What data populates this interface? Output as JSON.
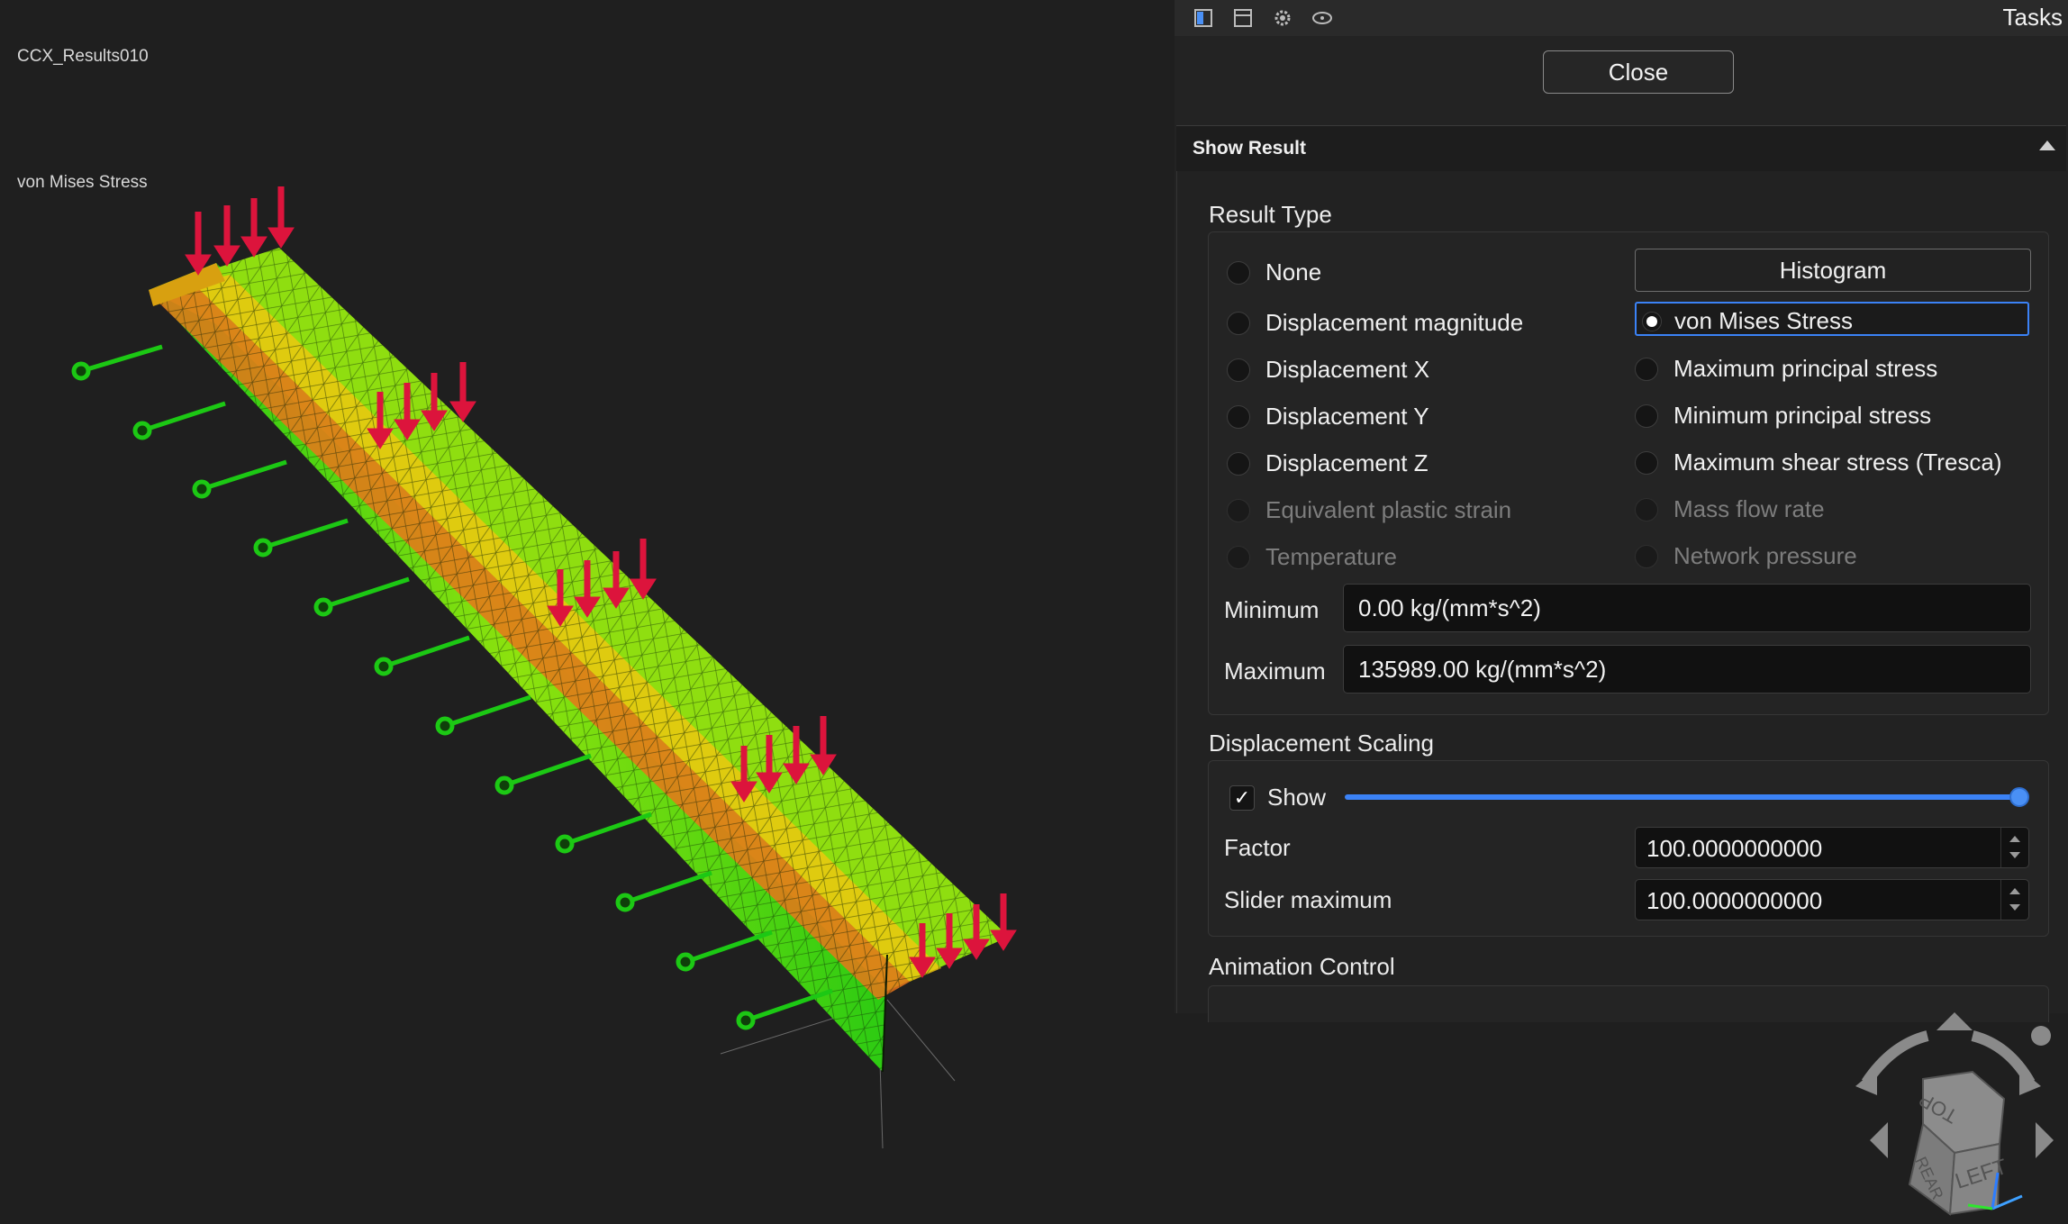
{
  "viewport": {
    "result_name": "CCX_Results010",
    "result_label": "von Mises Stress"
  },
  "tasks": {
    "title": "Tasks",
    "close_label": "Close",
    "toolbar_icons": [
      "panel-icon",
      "window-icon",
      "settings-icon",
      "eye-icon"
    ]
  },
  "show_result": {
    "title": "Show Result",
    "result_type": {
      "label": "Result Type",
      "left_options": [
        {
          "label": "None",
          "enabled": true
        },
        {
          "label": "Displacement magnitude",
          "enabled": true
        },
        {
          "label": "Displacement X",
          "enabled": true
        },
        {
          "label": "Displacement Y",
          "enabled": true
        },
        {
          "label": "Displacement Z",
          "enabled": true
        },
        {
          "label": "Equivalent plastic strain",
          "enabled": false
        },
        {
          "label": "Temperature",
          "enabled": false
        }
      ],
      "histogram_label": "Histogram",
      "right_options": [
        {
          "label": "von Mises Stress",
          "enabled": true,
          "checked": true
        },
        {
          "label": "Maximum principal stress",
          "enabled": true
        },
        {
          "label": "Minimum principal stress",
          "enabled": true
        },
        {
          "label": "Maximum shear stress (Tresca)",
          "enabled": true
        },
        {
          "label": "Mass flow rate",
          "enabled": false
        },
        {
          "label": "Network pressure",
          "enabled": false
        }
      ],
      "minimum_label": "Minimum",
      "minimum_value": "0.00 kg/(mm*s^2)",
      "maximum_label": "Maximum",
      "maximum_value": "135989.00 kg/(mm*s^2)"
    },
    "displacement_scaling": {
      "label": "Displacement Scaling",
      "show_label": "Show",
      "show_checked": true,
      "slider_fraction": 1.0,
      "factor_label": "Factor",
      "factor_value": "100.0000000000",
      "slider_max_label": "Slider maximum",
      "slider_max_value": "100.0000000000"
    },
    "animation_control": {
      "label": "Animation Control"
    }
  },
  "navcube": {
    "faces": [
      "TOP",
      "LEFT",
      "REAR"
    ]
  },
  "colors": {
    "accent": "#3b82f6",
    "load_arrow": "#dc143c",
    "stress_low": "#22cc11",
    "stress_mid": "#e8e000",
    "stress_high": "#e05a10"
  }
}
